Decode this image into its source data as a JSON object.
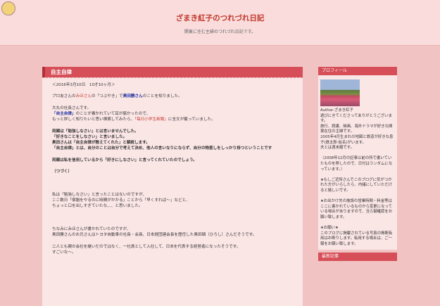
{
  "site": {
    "title": "ざまき紅子のつれづれ日記",
    "description": "関東に住む主婦のつれづれ日記です。"
  },
  "post": {
    "title": "自主自律",
    "date": "＜2016年3月10日　10才10ヶ月＞",
    "lines": [
      {
        "segments": [
          {
            "text": "プロ友さんの"
          },
          {
            "text": "みほさん",
            "style": "hl"
          },
          {
            "text": "の「つぶやき」で"
          },
          {
            "text": "奥田勝さん",
            "style": "blue"
          },
          {
            "text": "のことを知りました。"
          }
        ]
      },
      {
        "segments": []
      },
      {
        "segments": [
          {
            "text": "大丸の社長さんです。"
          }
        ]
      },
      {
        "segments": [
          {
            "text": "「自主自律」",
            "style": "blue"
          },
          {
            "text": "のことが書かれていて耳が痛かったので、"
          }
        ]
      },
      {
        "segments": [
          {
            "text": "もっと詳しく知りたいと思い検索してみたら、"
          },
          {
            "text": "「毎日小学生新聞」",
            "style": "hl"
          },
          {
            "text": "に全文が載っていました。"
          }
        ]
      },
      {
        "segments": []
      },
      {
        "segments": [
          {
            "text": "両親は「勉強しなさい」とは言いませんでした。",
            "style": "b"
          }
        ]
      },
      {
        "segments": [
          {
            "text": "「好きなことをしなさい」と言いました。",
            "style": "b"
          }
        ]
      },
      {
        "segments": [
          {
            "text": "奥田さんは「自主自律が教えてくれた」と解説します。",
            "style": "b"
          }
        ]
      },
      {
        "segments": [
          {
            "text": "「自主自律」とは、自分のことは自分で考えて決め、他人の言いなりにならず、自分の物差しをしっかり持つということです",
            "style": "b"
          }
        ]
      },
      {
        "segments": []
      },
      {
        "segments": [
          {
            "text": "両親は私を信用しているから「好きにしなさい」と言ってくれていたのでしょう。",
            "style": "b"
          }
        ]
      },
      {
        "segments": []
      },
      {
        "segments": [
          {
            "text": "（つづく）",
            "style": "b"
          }
        ]
      },
      {
        "segments": []
      },
      {
        "segments": []
      },
      {
        "segments": []
      },
      {
        "segments": [
          {
            "text": "私は「勉強しなさい」と言ったことはないのですが、"
          }
        ]
      },
      {
        "segments": [
          {
            "text": "ここ数日「宿題をやるのに時間がかかる」ことから「早くすれば〜」などと、"
          }
        ]
      },
      {
        "segments": [
          {
            "text": "ちょっと口を出しすぎていたな、、、と思いました。"
          }
        ]
      },
      {
        "segments": []
      },
      {
        "segments": []
      },
      {
        "segments": []
      },
      {
        "segments": [
          {
            "text": "ちなみにみほさんが書かれていたのですが、"
          }
        ]
      },
      {
        "segments": [
          {
            "text": "奥田勝さんのお兄さんはトヨタ自動車の社長・会長、日本経団連会長を歴任した奥田碩（ひろし）さんだそうです。"
          }
        ]
      },
      {
        "segments": []
      },
      {
        "segments": [
          {
            "text": "二人とも親の会社を継いだのではなく、一社員として入社して、日本を代表する経営者になったそうです。"
          }
        ]
      },
      {
        "segments": [
          {
            "text": "すごいな〜。"
          }
        ]
      }
    ]
  },
  "sidebar": {
    "profile_heading": "プロフィール",
    "profile_lines": [
      "Author:ざまき紅子",
      "遊びにきてくださってありがとうございます。",
      "旅行、読書、映画、海外ドラマが好きな関東在住の主婦です。",
      "2005年4月生まれの地図と鉄道が好きな息子(鉄太郎-仮名)がいます。",
      "夫とは週末婚です。",
      "",
      "（2008年12月の記事以前の所で書いていたものを移したので、日付はランダムになっています。）",
      "",
      "★もしご近所さんでこのブログに気がつかれた方がいらしたら、内緒にしていただけると嬉しいです。",
      "",
      "★お出かけ先の施設の営業時間・料金等はここに書かれているものから変更になっている場合がありますので、当ら御確認をお願い致します。",
      "",
      "★お願い★",
      "このブログに掲載されている写真の無断転用はお断りします。転用する場合は、ご一報をお願い致します。"
    ],
    "recent_heading": "最新記事"
  }
}
